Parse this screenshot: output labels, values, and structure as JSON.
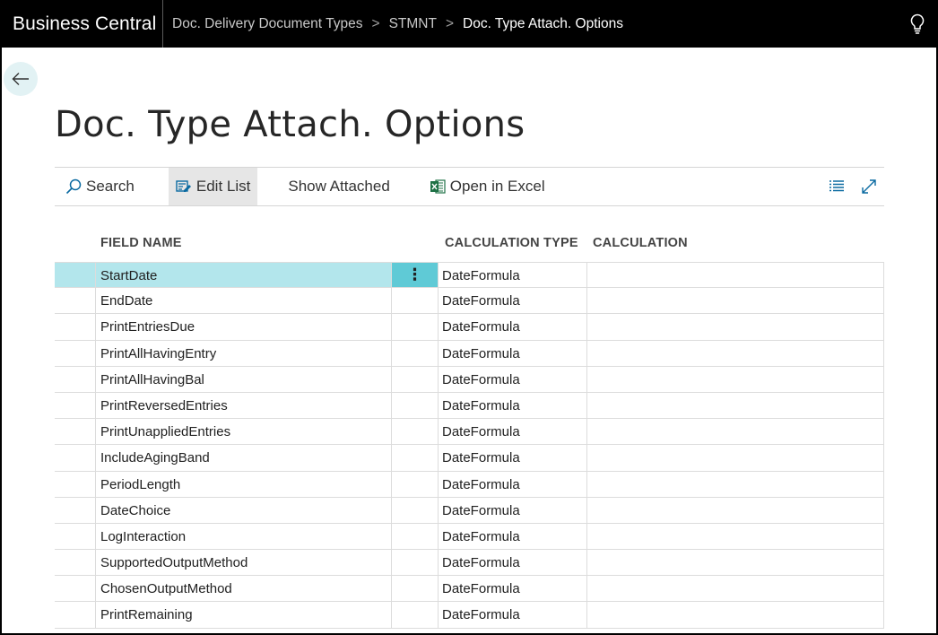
{
  "app": {
    "title": "Business Central"
  },
  "breadcrumb": {
    "items": [
      "Doc. Delivery Document Types",
      "STMNT"
    ],
    "current": "Doc. Type Attach. Options",
    "separator": ">"
  },
  "page": {
    "title": "Doc. Type Attach. Options"
  },
  "actions": {
    "search": "Search",
    "edit_list": "Edit List",
    "show_attached": "Show Attached",
    "open_excel": "Open in Excel"
  },
  "columns": {
    "field_name": "FIELD NAME",
    "calculation_type": "CALCULATION TYPE",
    "calculation": "CALCULATION"
  },
  "row_menu_glyph": "⋮",
  "rows": [
    {
      "field": "StartDate",
      "type": "DateFormula",
      "calc": ""
    },
    {
      "field": "EndDate",
      "type": "DateFormula",
      "calc": ""
    },
    {
      "field": "PrintEntriesDue",
      "type": "DateFormula",
      "calc": ""
    },
    {
      "field": "PrintAllHavingEntry",
      "type": "DateFormula",
      "calc": ""
    },
    {
      "field": "PrintAllHavingBal",
      "type": "DateFormula",
      "calc": ""
    },
    {
      "field": "PrintReversedEntries",
      "type": "DateFormula",
      "calc": ""
    },
    {
      "field": "PrintUnappliedEntries",
      "type": "DateFormula",
      "calc": ""
    },
    {
      "field": "IncludeAgingBand",
      "type": "DateFormula",
      "calc": ""
    },
    {
      "field": "PeriodLength",
      "type": "DateFormula",
      "calc": ""
    },
    {
      "field": "DateChoice",
      "type": "DateFormula",
      "calc": ""
    },
    {
      "field": "LogInteraction",
      "type": "DateFormula",
      "calc": ""
    },
    {
      "field": "SupportedOutputMethod",
      "type": "DateFormula",
      "calc": ""
    },
    {
      "field": "ChosenOutputMethod",
      "type": "DateFormula",
      "calc": ""
    },
    {
      "field": "PrintRemaining",
      "type": "DateFormula",
      "calc": ""
    }
  ],
  "colors": {
    "accent": "#00a4b4",
    "selected_row": "#b3e6ec",
    "row_menu": "#5fcad6",
    "excel_green": "#1e7145"
  }
}
